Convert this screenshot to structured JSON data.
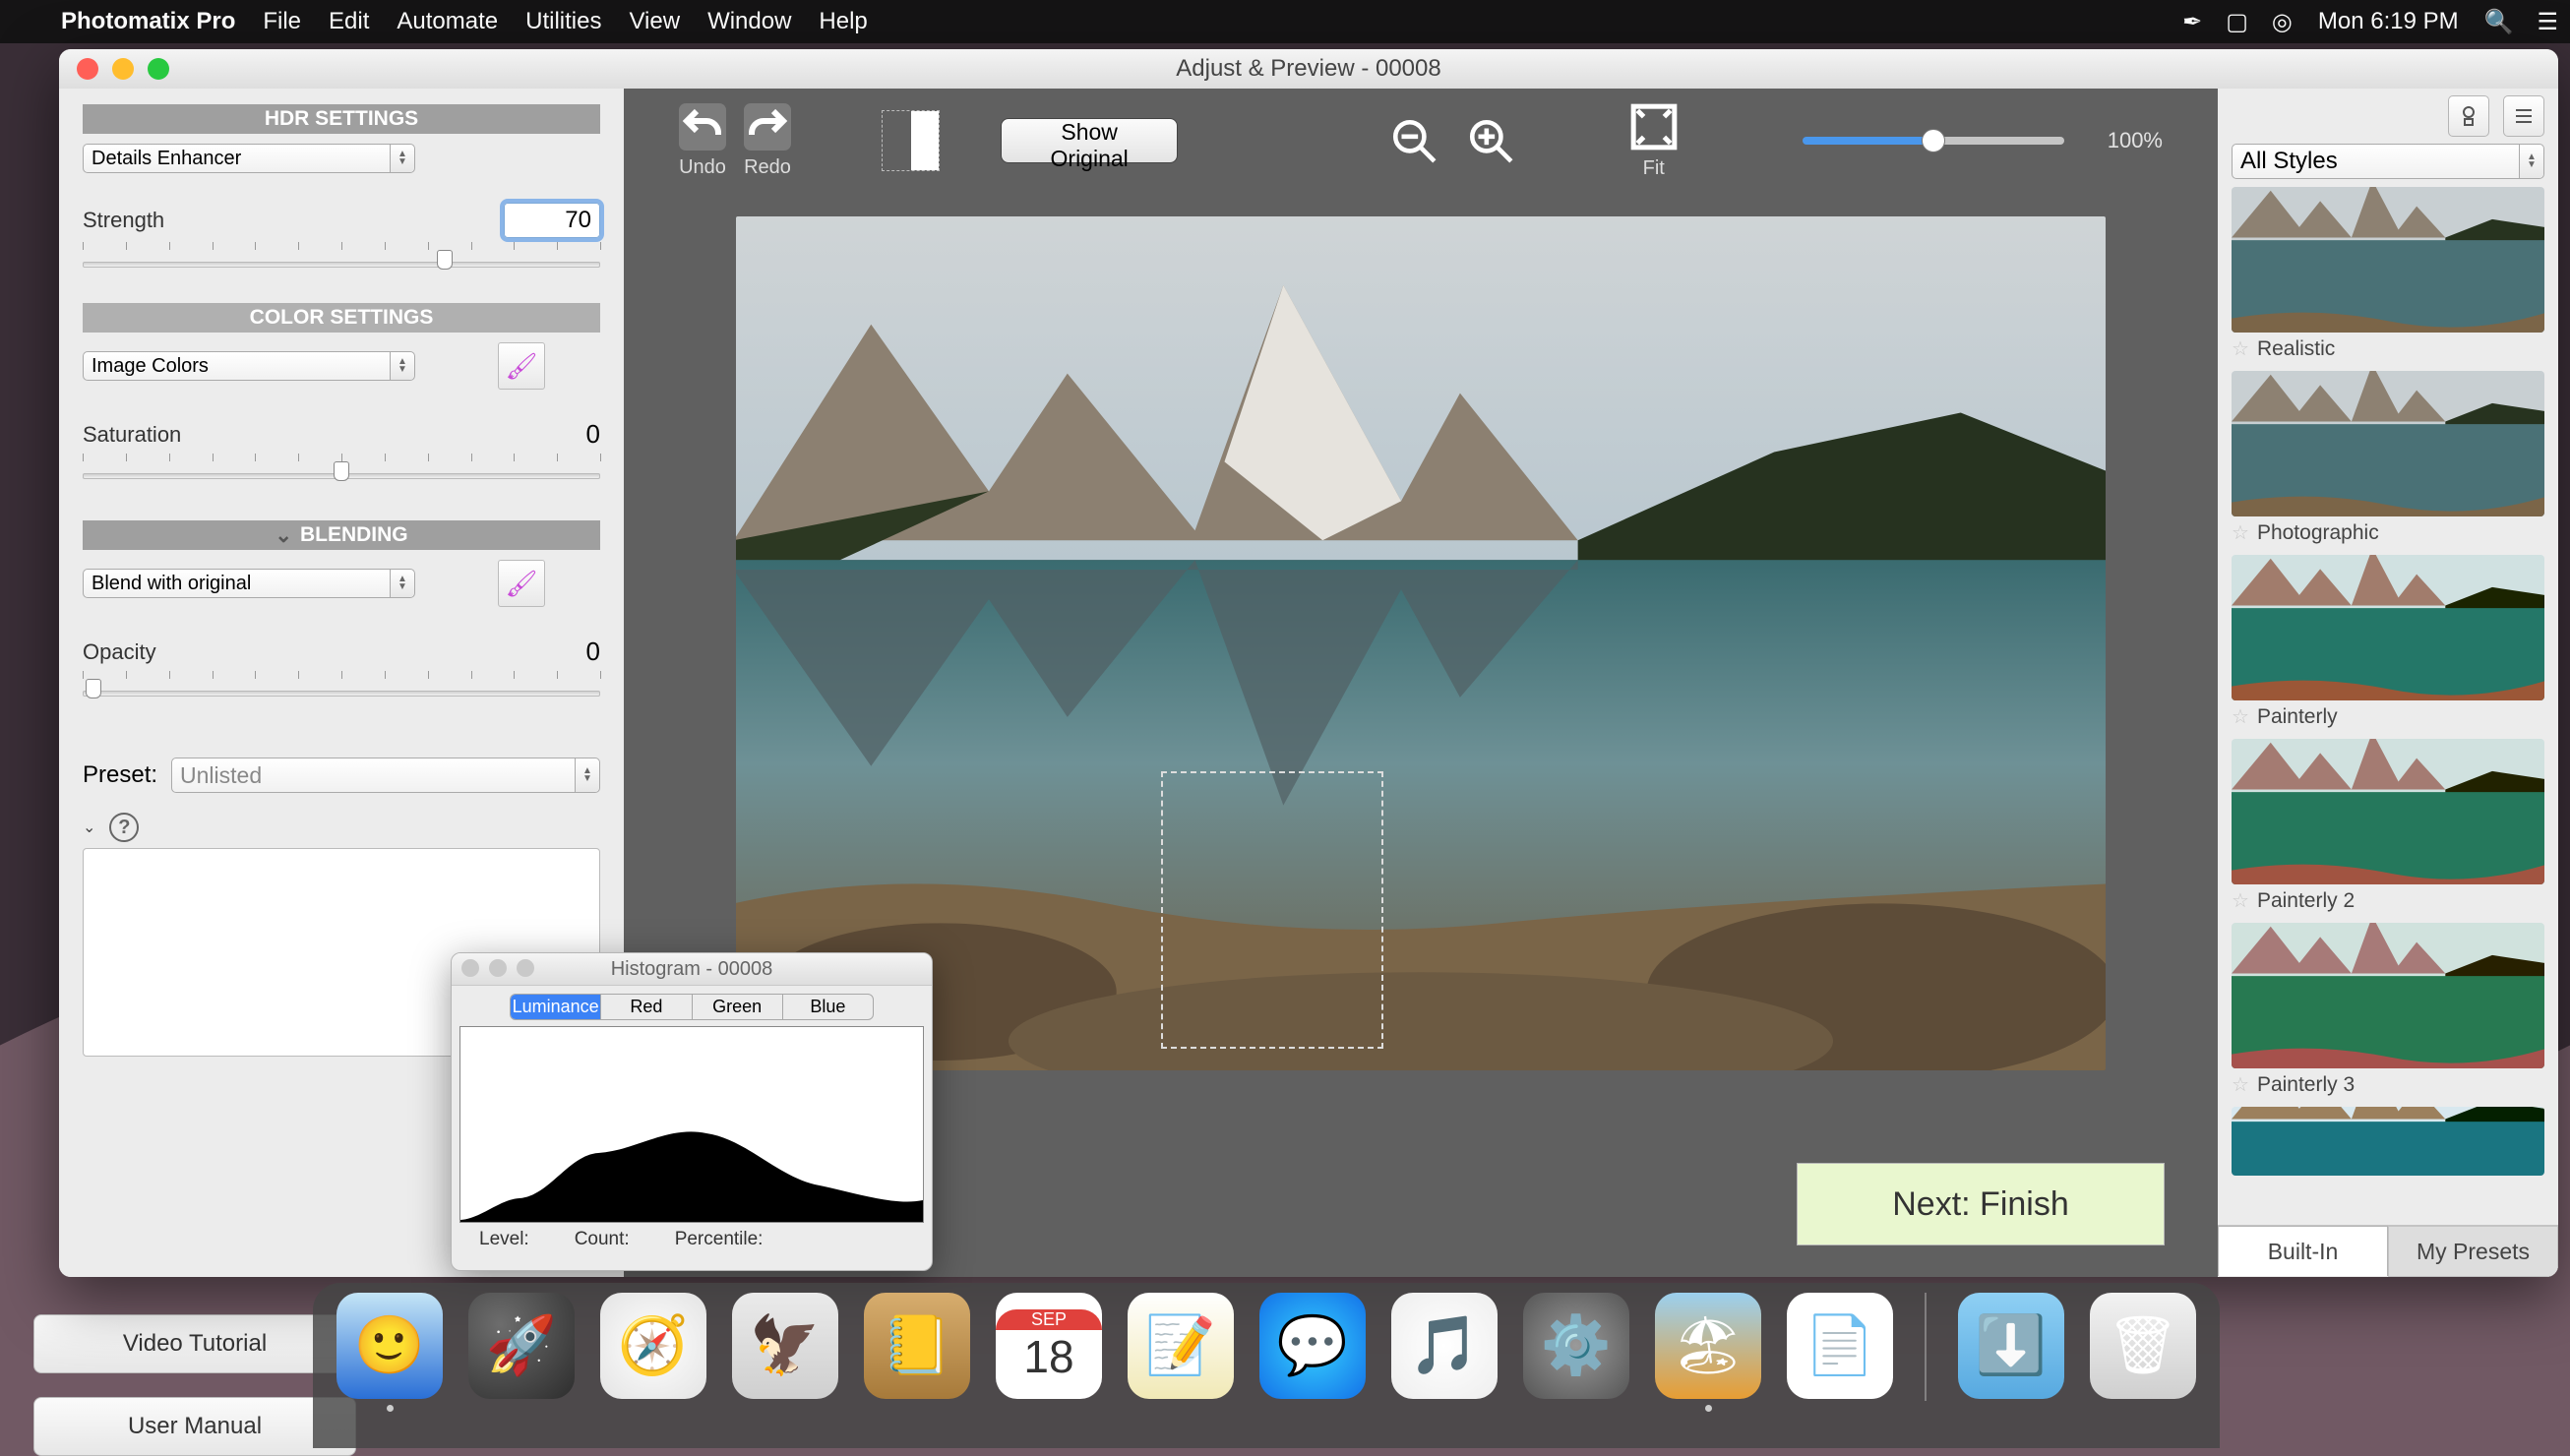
{
  "menubar": {
    "app": "Photomatix Pro",
    "items": [
      "File",
      "Edit",
      "Automate",
      "Utilities",
      "View",
      "Window",
      "Help"
    ],
    "clock": "Mon 6:19 PM"
  },
  "window": {
    "title": "Adjust & Preview - 00008"
  },
  "left": {
    "hdr_head": "HDR SETTINGS",
    "hdr_select": "Details Enhancer",
    "strength_label": "Strength",
    "strength_value": "70",
    "color_head": "COLOR SETTINGS",
    "color_select": "Image Colors",
    "saturation_label": "Saturation",
    "saturation_value": "0",
    "blend_head": "BLENDING",
    "blend_select": "Blend with original",
    "opacity_label": "Opacity",
    "opacity_value": "0",
    "preset_label": "Preset:",
    "preset_value": "Unlisted"
  },
  "toolbar": {
    "undo": "Undo",
    "redo": "Redo",
    "show_original": "Show Original",
    "fit": "Fit",
    "zoom_pct": "100%"
  },
  "next": "Next: Finish",
  "right": {
    "style_select": "All Styles",
    "presets": [
      "Realistic",
      "Photographic",
      "Painterly",
      "Painterly 2",
      "Painterly 3"
    ],
    "tab_builtin": "Built-In",
    "tab_my": "My Presets"
  },
  "histogram": {
    "title": "Histogram - 00008",
    "seg": [
      "Luminance",
      "Red",
      "Green",
      "Blue"
    ],
    "level": "Level:",
    "count": "Count:",
    "percentile": "Percentile:"
  },
  "bgbuttons": [
    "Video Tutorial",
    "User Manual"
  ]
}
